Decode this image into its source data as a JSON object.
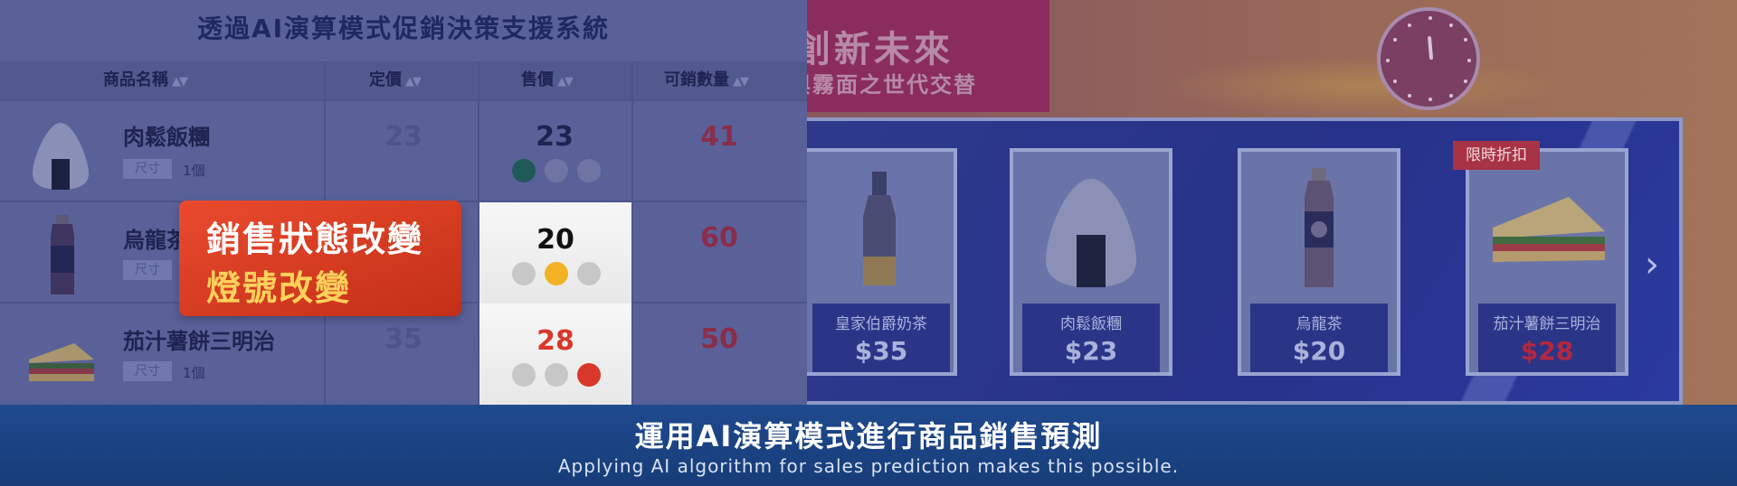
{
  "background": {
    "banner_title": "創新未來",
    "banner_subtitle": "與霧面之世代交替"
  },
  "display": {
    "products": [
      {
        "name": "皇家伯爵奶茶",
        "price": "$35",
        "icon": "bottle-icon"
      },
      {
        "name": "肉鬆飯糰",
        "price": "$23",
        "icon": "onigiri-icon"
      },
      {
        "name": "烏龍茶",
        "price": "$20",
        "icon": "tea-bottle-icon"
      },
      {
        "name": "茄汁薯餅三明治",
        "price": "$28",
        "icon": "sandwich-icon",
        "on_sale": true
      }
    ],
    "sale_tag": "限時折扣",
    "next_arrow": "›"
  },
  "table": {
    "title": "透過AI演算模式促銷決策支援系統",
    "headers": {
      "name": "商品名稱",
      "list_price": "定價",
      "sell_price": "售價",
      "quantity": "可銷數量"
    },
    "sort_glyph": "▲▼",
    "rows": [
      {
        "name": "肉鬆飯糰",
        "size_label": "尺寸",
        "unit": "1個",
        "list_price": "23",
        "sell_price": "23",
        "quantity": "41",
        "light": "green"
      },
      {
        "name": "烏龍茶",
        "size_label": "尺寸",
        "unit": "",
        "list_price": "",
        "sell_price": "20",
        "quantity": "60",
        "light": "yellow"
      },
      {
        "name": "茄汁薯餅三明治",
        "size_label": "尺寸",
        "unit": "1個",
        "list_price": "35",
        "sell_price": "28",
        "quantity": "50",
        "light": "red"
      }
    ]
  },
  "callout": {
    "line1": "銷售狀態改變",
    "line2": "燈號改變"
  },
  "subtitle": {
    "zh": "運用AI演算模式進行商品銷售預測",
    "en": "Applying AI algorithm for sales prediction makes this possible."
  },
  "colors": {
    "light_green": "#1f5a58",
    "light_yellow": "#f2b224",
    "light_red": "#d9372a",
    "light_off": "#c7c7c7",
    "callout": "#e4452a",
    "subtitle_bar": "#1f4a8e"
  }
}
